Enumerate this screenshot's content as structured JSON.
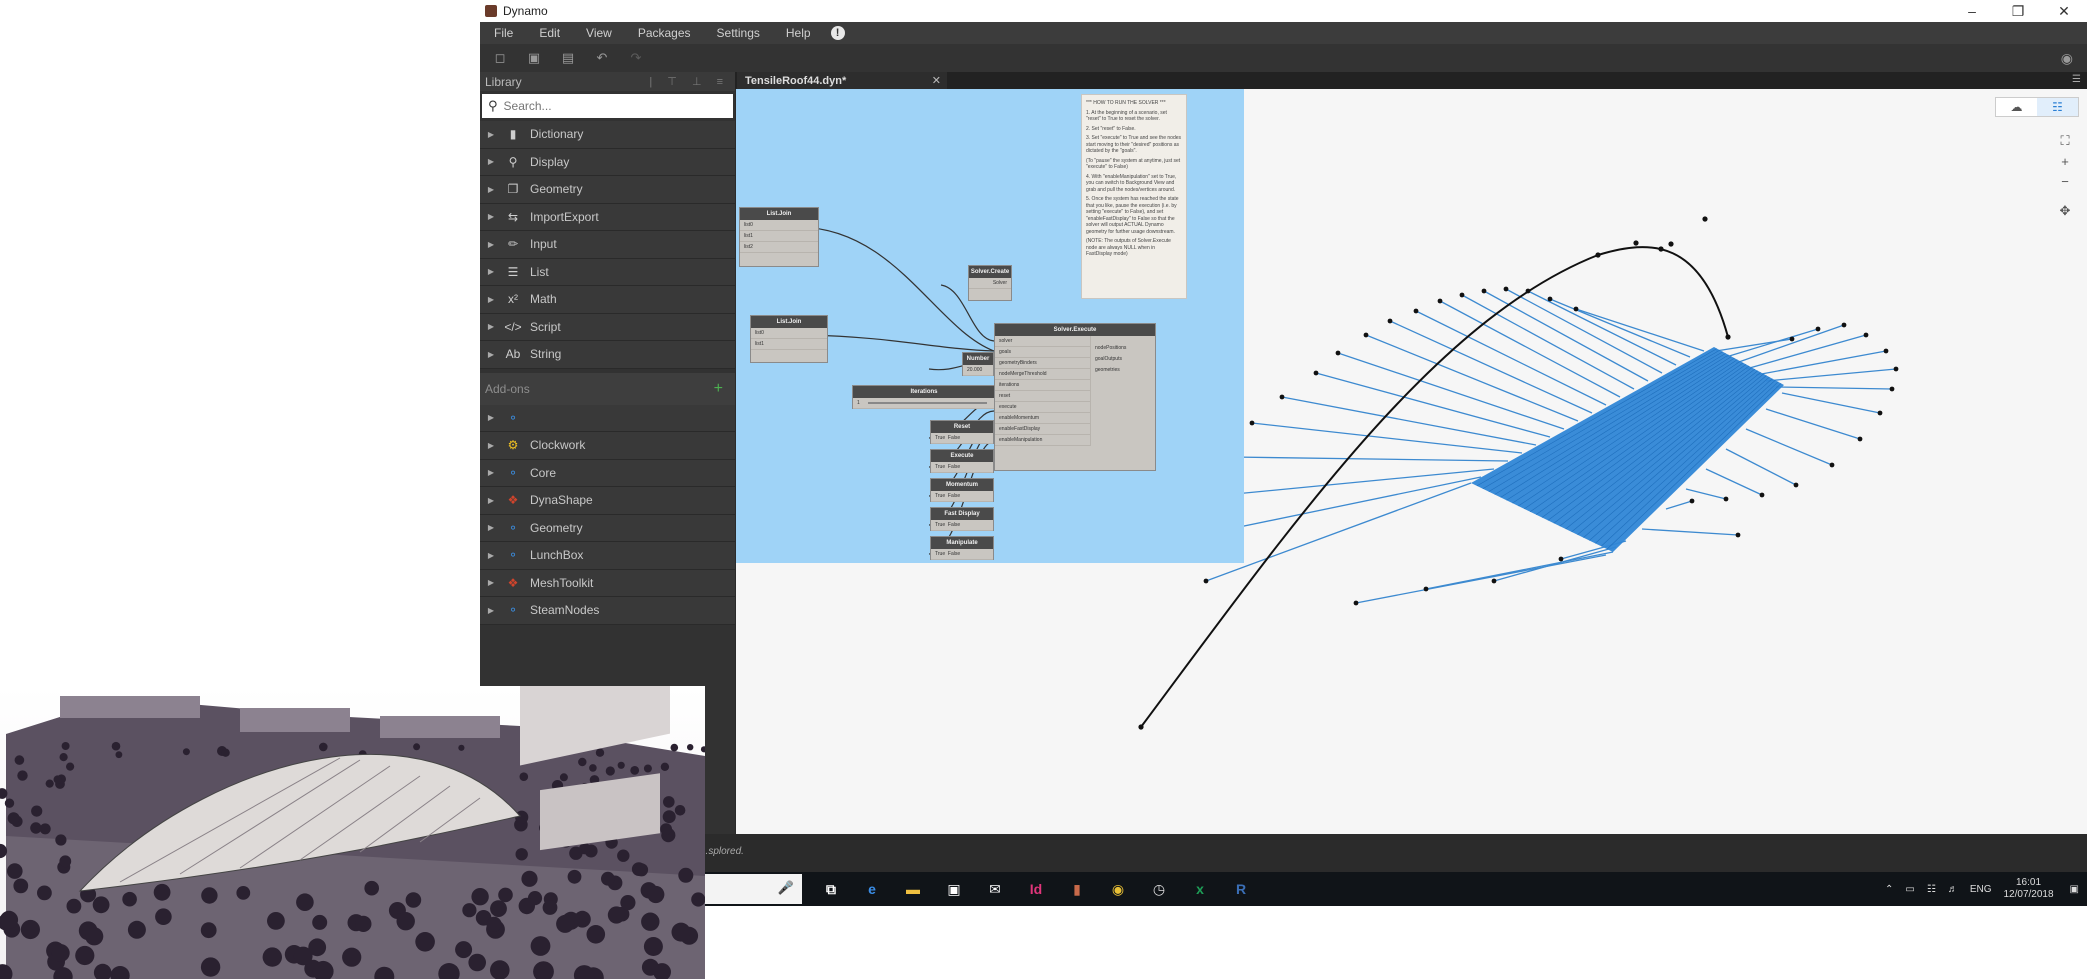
{
  "window": {
    "title": "Dynamo",
    "controls": {
      "minimize": "–",
      "restore": "❐",
      "close": "✕"
    }
  },
  "menu": [
    "File",
    "Edit",
    "View",
    "Packages",
    "Settings",
    "Help",
    "!"
  ],
  "library": {
    "title": "Library",
    "search_placeholder": "Search...",
    "categories": [
      {
        "label": "Dictionary",
        "icon": "book-icon"
      },
      {
        "label": "Display",
        "icon": "magnifier-icon"
      },
      {
        "label": "Geometry",
        "icon": "cube-icon"
      },
      {
        "label": "ImportExport",
        "icon": "arrows-icon"
      },
      {
        "label": "Input",
        "icon": "pencil-icon"
      },
      {
        "label": "List",
        "icon": "list-icon"
      },
      {
        "label": "Math",
        "icon": "math-icon"
      },
      {
        "label": "Script",
        "icon": "code-icon"
      },
      {
        "label": "String",
        "icon": "string-icon"
      }
    ],
    "addons_title": "Add-ons",
    "addons": [
      {
        "label": "",
        "icon": "package-icon"
      },
      {
        "label": "Clockwork",
        "icon": "clockwork-icon"
      },
      {
        "label": "Core",
        "icon": "package-icon"
      },
      {
        "label": "DynaShape",
        "icon": "dynashape-icon"
      },
      {
        "label": "Geometry",
        "icon": "package-icon"
      },
      {
        "label": "LunchBox",
        "icon": "package-icon"
      },
      {
        "label": "MeshToolkit",
        "icon": "meshtoolkit-icon"
      },
      {
        "label": "SteamNodes",
        "icon": "package-icon"
      }
    ]
  },
  "tab": {
    "label": "TensileRoof44.dyn*",
    "close": "✕"
  },
  "nodes": {
    "listjoin1": {
      "title": "List.Join",
      "ports": [
        "list0",
        "list1",
        "list2"
      ]
    },
    "listjoin2": {
      "title": "List.Join",
      "ports": [
        "list0",
        "list1"
      ]
    },
    "solver_create": {
      "title": "Solver.Create",
      "port": "Solver"
    },
    "number": {
      "title": "Number",
      "value": "20.000"
    },
    "iterations": {
      "title": "Iterations",
      "value": "1"
    },
    "reset": {
      "title": "Reset",
      "true": "True",
      "false": "False"
    },
    "execute": {
      "title": "Execute",
      "true": "True",
      "false": "False"
    },
    "momentum": {
      "title": "Momentum",
      "true": "True",
      "false": "False"
    },
    "fast_display": {
      "title": "Fast Display",
      "true": "True",
      "false": "False"
    },
    "manipulate": {
      "title": "Manipulate",
      "true": "True",
      "false": "False"
    },
    "solver_execute": {
      "title": "Solver.Execute",
      "inputs": [
        "solver",
        "goals",
        "geometryBinders",
        "nodeMergeThreshold",
        "iterations",
        "reset",
        "execute",
        "enableMomentum",
        "enableFastDisplay",
        "enableManipulation"
      ],
      "outputs": [
        "nodePositions",
        "goalOutputs",
        "geometries"
      ]
    }
  },
  "note": {
    "title": "*** HOW TO RUN THE SOLVER ***",
    "lines": [
      "1. At the beginning of a scenario, set \"reset\" to True to reset the solver.",
      "2. Set \"reset\" to False.",
      "3. Set \"execute\" to True and see the nodes start moving to their \"desired\" positions as dictated by the \"goals\".",
      "(To \"pause\" the system at anytime, just set \"execute\" to False)",
      "4. With \"enableManipulation\" set to True, you can switch to Background View and grab and pull the nodes/vertices around.",
      "5. Once the system has reached the state that you like, pause the execution (i.e. by setting \"execute\" to False), and set \"enableFastDisplay\" to False so that the solver will output ACTUAL Dynamo geometry for further usage downstream.",
      "(NOTE: The outputs of Solver.Execute node are always NULL when in FastDisplay mode)"
    ]
  },
  "status": {
    "text": "...splored."
  },
  "taskbar": {
    "apps": [
      {
        "name": "task-view-icon",
        "glyph": "⧉",
        "color": "#ffffff"
      },
      {
        "name": "edge-icon",
        "glyph": "e",
        "color": "#3a8de6"
      },
      {
        "name": "folder-icon",
        "glyph": "▬",
        "color": "#f0c040"
      },
      {
        "name": "store-icon",
        "glyph": "▣",
        "color": "#ffffff"
      },
      {
        "name": "mail-icon",
        "glyph": "✉",
        "color": "#ffffff"
      },
      {
        "name": "indesign-icon",
        "glyph": "Id",
        "color": "#e0357a"
      },
      {
        "name": "dynamo-icon",
        "glyph": "▮",
        "color": "#c86a4a"
      },
      {
        "name": "chrome-icon",
        "glyph": "◉",
        "color": "#e8c036"
      },
      {
        "name": "clock-app-icon",
        "glyph": "◷",
        "color": "#dddddd"
      },
      {
        "name": "excel-icon",
        "glyph": "x",
        "color": "#1e9e57"
      },
      {
        "name": "revit-icon",
        "glyph": "R",
        "color": "#3b6fb6"
      }
    ],
    "language": "ENG",
    "time": "16:01",
    "date": "12/07/2018"
  },
  "colors": {
    "graph_background": "#9fd3f7",
    "mesh": "#2f86d6",
    "cable": "#3d8ad0",
    "curve": "#111111"
  }
}
